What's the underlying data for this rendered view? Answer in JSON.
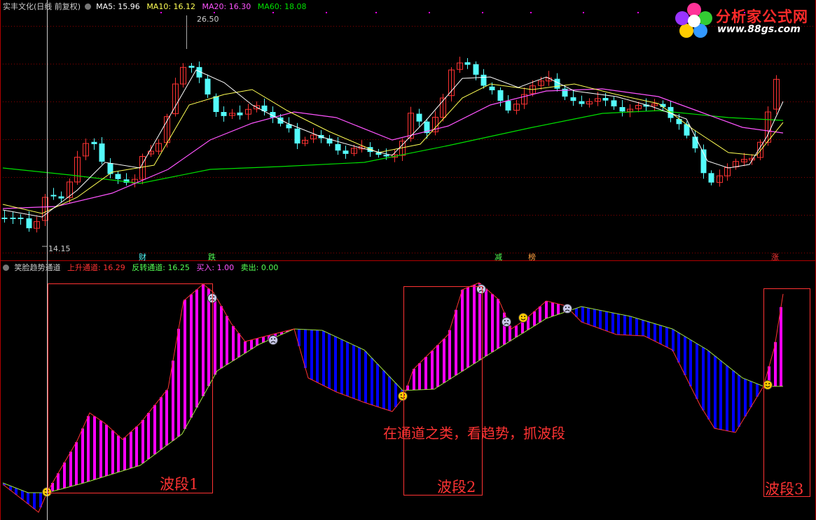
{
  "top_header": {
    "title": "实丰文化(日线 前复权)",
    "ma5": "MA5: 15.96",
    "ma10": "MA10: 16.12",
    "ma20": "MA20: 16.30",
    "ma60": "MA60: 18.08"
  },
  "price_labels": {
    "high": "26.50",
    "low": "14.15"
  },
  "event_flags": [
    "财",
    "跌",
    "减",
    "榜",
    "涨"
  ],
  "bottom_header": {
    "title": "笑脸趋势通道",
    "up_label": "上升通道:",
    "up_value": "16.29",
    "rev_label": "反转通道:",
    "rev_value": "16.25",
    "buy_label": "买入:",
    "buy_value": "1.00",
    "sell_label": "卖出:",
    "sell_value": "0.00"
  },
  "logo": {
    "title": "分析家公式网",
    "url": "www.88gs.com"
  },
  "waves": [
    "波段1",
    "波段2",
    "波段3"
  ],
  "annotation": "在通道之类，看趋势，抓波段",
  "colors": {
    "up": "#ff3333",
    "down": "#54fcfc",
    "ma5": "#ffffff",
    "ma10": "#ffff54",
    "ma20": "#ff54ff",
    "ma60": "#00e000",
    "bull_bar": "#ff00ff",
    "bear_bar": "#0000ff"
  }
}
